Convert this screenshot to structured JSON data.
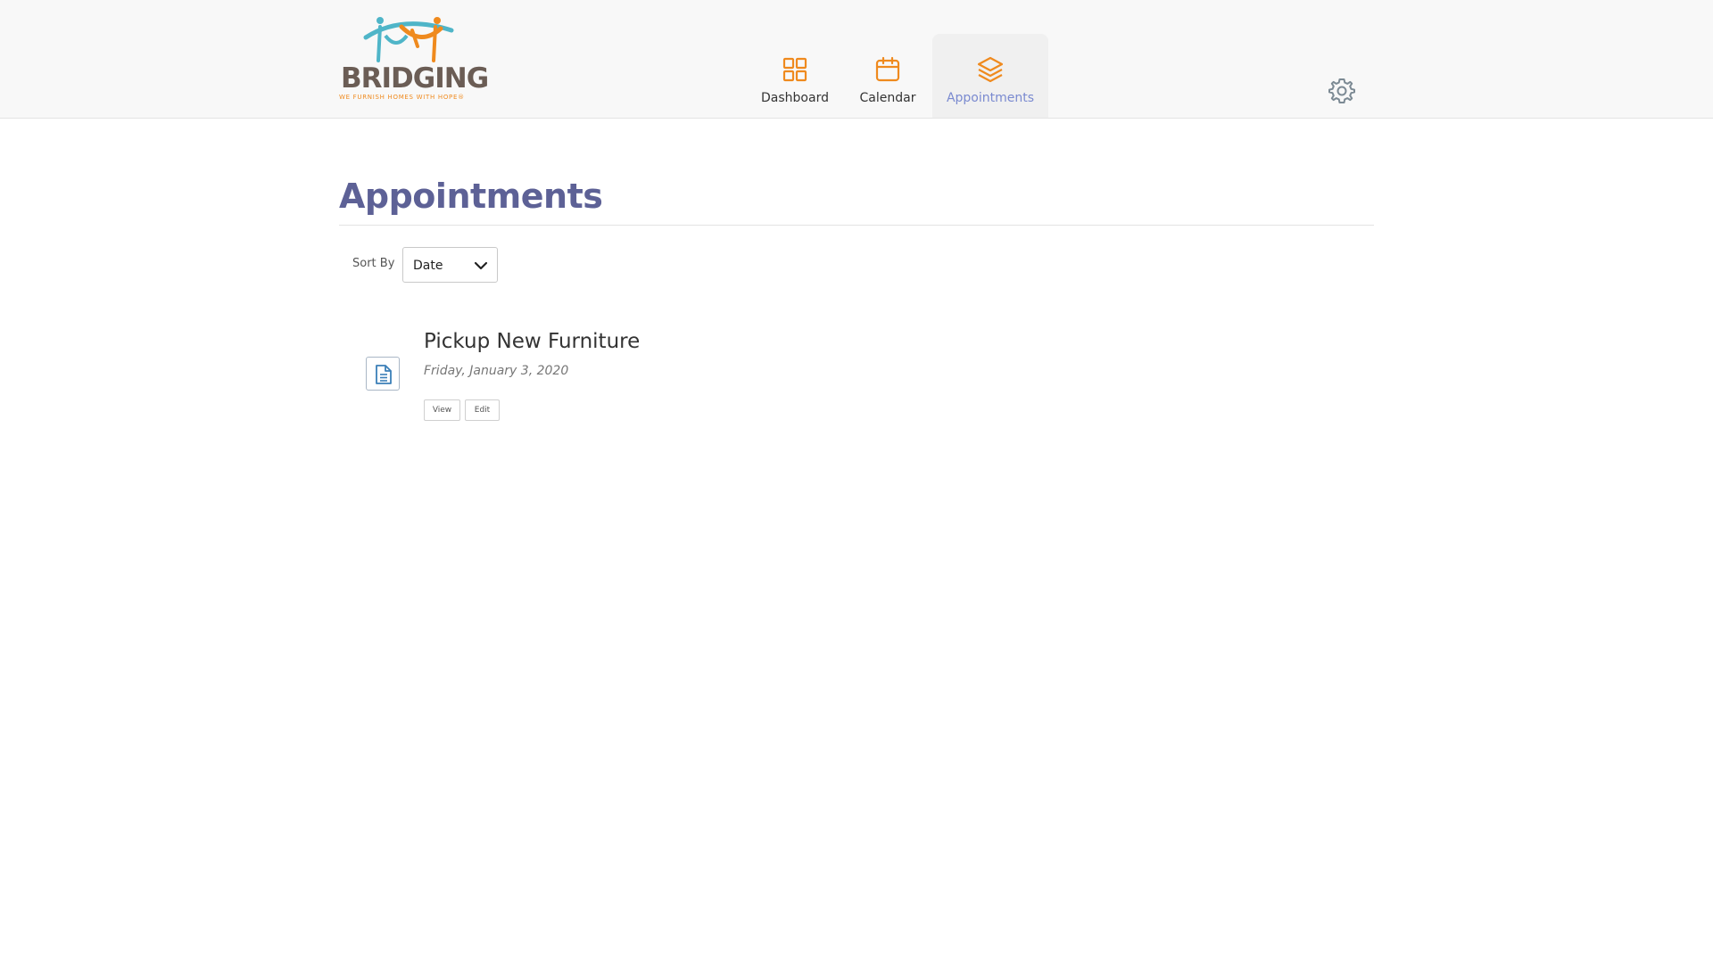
{
  "brand": {
    "name": "BRIDGING",
    "tagline": "WE FURNISH HOMES WITH HOPE®",
    "colors": {
      "teal": "#4fb5c8",
      "orange": "#ef8a1e",
      "brown": "#6b5d55"
    }
  },
  "nav": {
    "items": [
      {
        "label": "Dashboard",
        "icon": "grid-icon",
        "active": false
      },
      {
        "label": "Calendar",
        "icon": "calendar-icon",
        "active": false
      },
      {
        "label": "Appointments",
        "icon": "layers-icon",
        "active": true
      }
    ],
    "icon_color": "#ef8a1e",
    "active_label_color": "#7a8ad0"
  },
  "settings": {
    "icon": "gear-icon"
  },
  "page": {
    "title": "Appointments",
    "title_color": "#5d6196"
  },
  "sort": {
    "label": "Sort By",
    "selected": "Date"
  },
  "appointments": [
    {
      "title": "Pickup New Furniture",
      "date": "Friday, January 3, 2020",
      "icon": "document-icon",
      "actions": {
        "view": "View",
        "edit": "Edit"
      }
    }
  ]
}
